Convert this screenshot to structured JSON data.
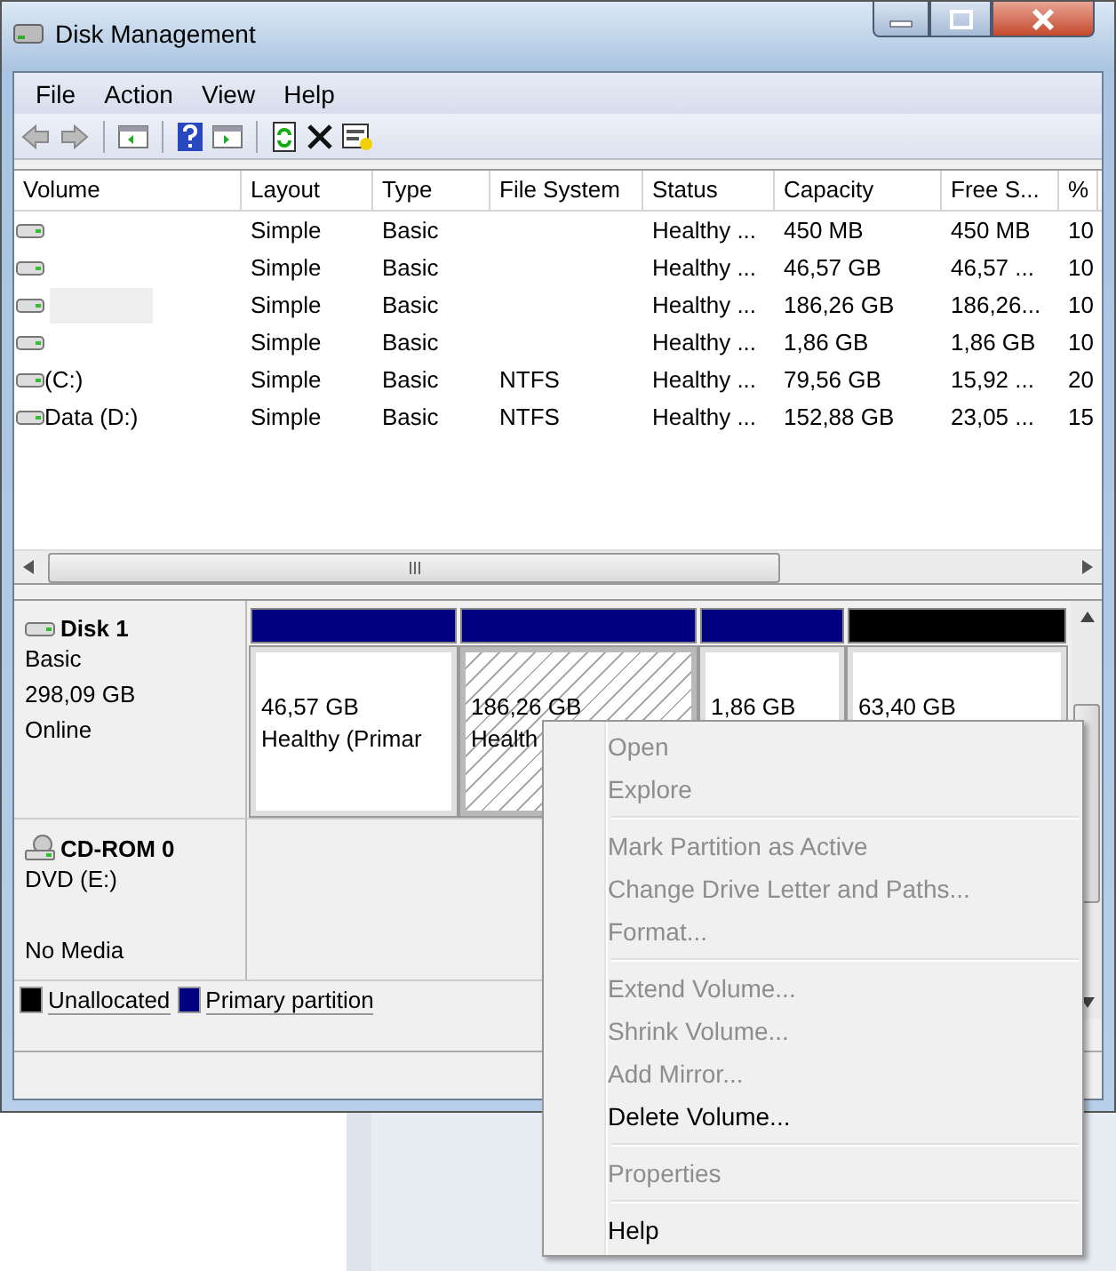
{
  "window": {
    "title": "Disk Management"
  },
  "menu_bar": [
    "File",
    "Action",
    "View",
    "Help"
  ],
  "table": {
    "columns": [
      "Volume",
      "Layout",
      "Type",
      "File System",
      "Status",
      "Capacity",
      "Free S...",
      "%"
    ],
    "rows": [
      {
        "redacted": false,
        "cells": [
          "",
          "Simple",
          "Basic",
          "",
          "Healthy ...",
          "450 MB",
          "450 MB",
          "10"
        ]
      },
      {
        "redacted": false,
        "cells": [
          "",
          "Simple",
          "Basic",
          "",
          "Healthy ...",
          "46,57 GB",
          "46,57 ...",
          "10"
        ]
      },
      {
        "redacted": true,
        "cells": [
          "",
          "Simple",
          "Basic",
          "",
          "Healthy ...",
          "186,26 GB",
          "186,26...",
          "10"
        ]
      },
      {
        "redacted": false,
        "cells": [
          "",
          "Simple",
          "Basic",
          "",
          "Healthy ...",
          "1,86 GB",
          "1,86 GB",
          "10"
        ]
      },
      {
        "redacted": false,
        "cells": [
          " (C:)",
          "Simple",
          "Basic",
          "NTFS",
          "Healthy ...",
          "79,56 GB",
          "15,92 ...",
          "20"
        ]
      },
      {
        "redacted": false,
        "cells": [
          "Data (D:)",
          "Simple",
          "Basic",
          "NTFS",
          "Healthy ...",
          "152,88 GB",
          "23,05 ...",
          "15"
        ]
      }
    ]
  },
  "disks": [
    {
      "kind": "disk",
      "name": "Disk 1",
      "type": "Basic",
      "size": "298,09 GB",
      "status": "Online",
      "partitions": [
        {
          "color": "#000080",
          "selected": false,
          "size": "46,57 GB",
          "status": "Healthy (Primar"
        },
        {
          "color": "#000080",
          "selected": true,
          "size": "186,26 GB",
          "status": "Health"
        },
        {
          "color": "#000080",
          "selected": false,
          "size": "1,86 GB"
        },
        {
          "color": "#000000",
          "selected": false,
          "size": "63,40 GB"
        }
      ]
    },
    {
      "kind": "cdrom",
      "name": "CD-ROM 0",
      "type": "DVD (E:)",
      "status": "No Media"
    }
  ],
  "legend": [
    {
      "color": "#000000",
      "label": "Unallocated"
    },
    {
      "color": "#000080",
      "label": "Primary partition"
    }
  ],
  "context_menu": [
    {
      "kind": "item",
      "label": "Open",
      "disabled": true
    },
    {
      "kind": "item",
      "label": "Explore",
      "disabled": true
    },
    {
      "kind": "separator"
    },
    {
      "kind": "item",
      "label": "Mark Partition as Active",
      "disabled": true
    },
    {
      "kind": "item",
      "label": "Change Drive Letter and Paths...",
      "disabled": true
    },
    {
      "kind": "item",
      "label": "Format...",
      "disabled": true
    },
    {
      "kind": "separator"
    },
    {
      "kind": "item",
      "label": "Extend Volume...",
      "disabled": true
    },
    {
      "kind": "item",
      "label": "Shrink Volume...",
      "disabled": true
    },
    {
      "kind": "item",
      "label": "Add Mirror...",
      "disabled": true
    },
    {
      "kind": "item",
      "label": "Delete Volume...",
      "disabled": false
    },
    {
      "kind": "separator"
    },
    {
      "kind": "item",
      "label": "Properties",
      "disabled": true
    },
    {
      "kind": "separator"
    },
    {
      "kind": "item",
      "label": "Help",
      "disabled": false
    }
  ]
}
